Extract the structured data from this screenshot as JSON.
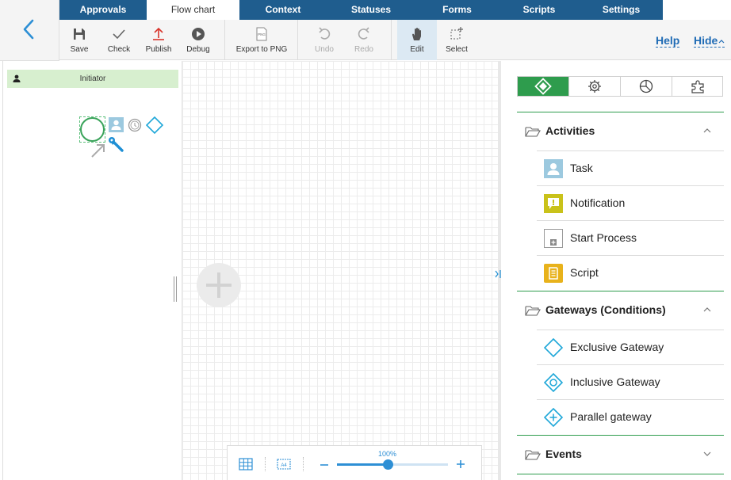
{
  "tabs": [
    {
      "label": "Approvals"
    },
    {
      "label": "Flow chart"
    },
    {
      "label": "Context"
    },
    {
      "label": "Statuses"
    },
    {
      "label": "Forms"
    },
    {
      "label": "Scripts"
    },
    {
      "label": "Settings"
    }
  ],
  "toolbar": {
    "save": "Save",
    "check": "Check",
    "publish": "Publish",
    "debug": "Debug",
    "export": "Export to PNG",
    "export_icon_text": "PNG",
    "undo": "Undo",
    "redo": "Redo",
    "edit": "Edit",
    "select": "Select",
    "help": "Help",
    "hide": "Hide"
  },
  "lane": {
    "title": "Initiator"
  },
  "zoom": {
    "level_text": "100%",
    "level": 1.0,
    "page_icon_text": "A4"
  },
  "palette": {
    "sections": [
      {
        "title": "Activities",
        "expanded": true,
        "items": [
          "Task",
          "Notification",
          "Start Process",
          "Script"
        ]
      },
      {
        "title": "Gateways (Conditions)",
        "expanded": true,
        "items": [
          "Exclusive Gateway",
          "Inclusive Gateway",
          "Parallel gateway"
        ]
      },
      {
        "title": "Events",
        "expanded": false,
        "items": []
      }
    ]
  },
  "colors": {
    "tab_bar": "#1f5d8e",
    "accent_green": "#2e9c4d",
    "link_blue": "#1f6bb5",
    "lane_header": "#d7efcf",
    "gateway_cyan": "#1ea7d8",
    "notification_yellow": "#c9c21a",
    "script_yellow": "#e8b21b",
    "task_blue": "#9cc9df",
    "publish_red": "#d9342b"
  }
}
